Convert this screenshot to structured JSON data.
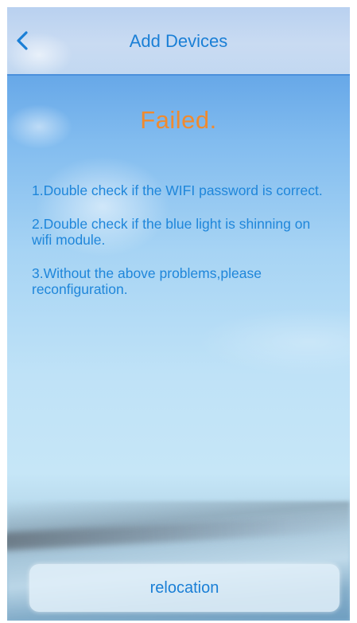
{
  "header": {
    "title": "Add Devices",
    "back_icon": "chevron-left-icon"
  },
  "status": {
    "text": "Failed.",
    "color": "#f08a2e"
  },
  "tips": [
    "1.Double check if the WIFI password is correct.",
    "2.Double check if the blue light is shinning on wifi module.",
    "3.Without the above problems,please reconfiguration."
  ],
  "actions": {
    "relocation_label": "relocation"
  },
  "colors": {
    "accent": "#1a7fd6",
    "header_border": "#4a8fdc"
  }
}
